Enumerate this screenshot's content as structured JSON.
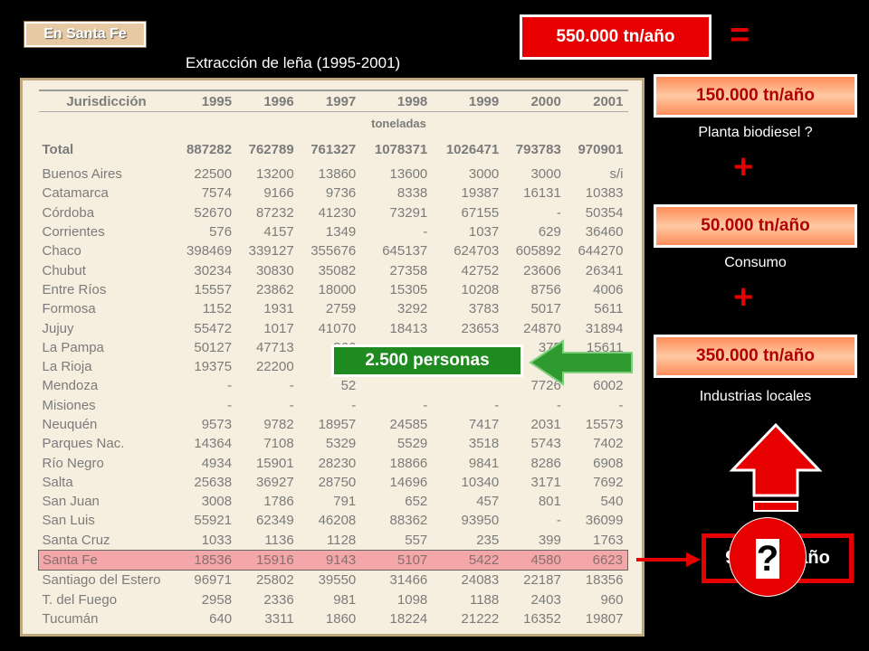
{
  "tag": "En Santa Fe",
  "subtitle": "Extracción de leña (1995-2001)",
  "table": {
    "columns": [
      "Jurisdicción",
      "1995",
      "1996",
      "1997",
      "1998",
      "1999",
      "2000",
      "2001"
    ],
    "units": "toneladas",
    "total": [
      "Total",
      "887282",
      "762789",
      "761327",
      "1078371",
      "1026471",
      "793783",
      "970901"
    ],
    "rows": [
      [
        "Buenos Aires",
        "22500",
        "13200",
        "13860",
        "13600",
        "3000",
        "3000",
        "s/i"
      ],
      [
        "Catamarca",
        "7574",
        "9166",
        "9736",
        "8338",
        "19387",
        "16131",
        "10383"
      ],
      [
        "Córdoba",
        "52670",
        "87232",
        "41230",
        "73291",
        "67155",
        "-",
        "50354"
      ],
      [
        "Corrientes",
        "576",
        "4157",
        "1349",
        "-",
        "1037",
        "629",
        "36460"
      ],
      [
        "Chaco",
        "398469",
        "339127",
        "355676",
        "645137",
        "624703",
        "605892",
        "644270"
      ],
      [
        "Chubut",
        "30234",
        "30830",
        "35082",
        "27358",
        "42752",
        "23606",
        "26341"
      ],
      [
        "Entre Ríos",
        "15557",
        "23862",
        "18000",
        "15305",
        "10208",
        "8756",
        "4006"
      ],
      [
        "Formosa",
        "1152",
        "1931",
        "2759",
        "3292",
        "3783",
        "5017",
        "5611"
      ],
      [
        "Jujuy",
        "55472",
        "1017",
        "41070",
        "18413",
        "23653",
        "24870",
        "31894"
      ],
      [
        "La Pampa",
        "50127",
        "47713",
        "366",
        "",
        "",
        "375",
        "15611"
      ],
      [
        "La Rioja",
        "19375",
        "22200",
        "197",
        "",
        "",
        "5",
        ""
      ],
      [
        "Mendoza",
        "-",
        "-",
        "52",
        "",
        "",
        "7726",
        "6002"
      ],
      [
        "Misiones",
        "-",
        "-",
        "-",
        "-",
        "-",
        "-",
        "-"
      ],
      [
        "Neuquén",
        "9573",
        "9782",
        "18957",
        "24585",
        "7417",
        "2031",
        "15573"
      ],
      [
        "Parques Nac.",
        "14364",
        "7108",
        "5329",
        "5529",
        "3518",
        "5743",
        "7402"
      ],
      [
        "Río Negro",
        "4934",
        "15901",
        "28230",
        "18866",
        "9841",
        "8286",
        "6908"
      ],
      [
        "Salta",
        "25638",
        "36927",
        "28750",
        "14696",
        "10340",
        "3171",
        "7692"
      ],
      [
        "San Juan",
        "3008",
        "1786",
        "791",
        "652",
        "457",
        "801",
        "540"
      ],
      [
        "San Luis",
        "55921",
        "62349",
        "46208",
        "88362",
        "93950",
        "-",
        "36099"
      ],
      [
        "Santa Cruz",
        "1033",
        "1136",
        "1128",
        "557",
        "235",
        "399",
        "1763"
      ],
      [
        "Santa Fe",
        "18536",
        "15916",
        "9143",
        "5107",
        "5422",
        "4580",
        "6623"
      ],
      [
        "Santiago del Estero",
        "96971",
        "25802",
        "39550",
        "31466",
        "24083",
        "22187",
        "18356"
      ],
      [
        "T. del Fuego",
        "2958",
        "2336",
        "981",
        "1098",
        "1188",
        "2403",
        "960"
      ],
      [
        "Tucumán",
        "640",
        "3311",
        "1860",
        "18224",
        "21222",
        "16352",
        "19807"
      ]
    ]
  },
  "right": {
    "total_box": "550.000 tn/año",
    "equals": "=",
    "box1": "150.000 tn/año",
    "caption1": "Planta biodiesel ?",
    "plus1": "+",
    "box2": "50.000 tn/año",
    "caption2": "Consumo",
    "plus2": "+",
    "box3": "350.000 tn/año",
    "caption3": "Industrias locales",
    "result": "9.183 tn/año",
    "question": "?"
  },
  "persons": "2.500 personas",
  "colors": {
    "red": "#e60000",
    "green": "#1f8a1f",
    "orange": "#ff8d5a"
  }
}
